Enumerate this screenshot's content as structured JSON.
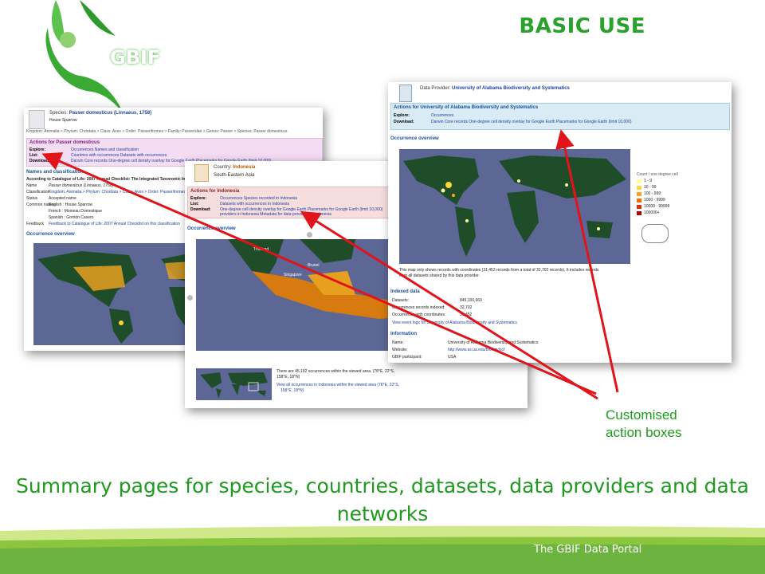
{
  "slide": {
    "title": "BASIC USE",
    "logo_text": "GBIF",
    "subtitle": "Summary pages for species, countries, datasets, data providers and data networks",
    "footer": "The GBIF Data Portal",
    "callout": "Customised action boxes"
  },
  "species_page": {
    "label": "Species:",
    "name": "Passer domesticus (Linnaeus, 1758)",
    "common_name": "House Sparrow",
    "taxonomy": "Kingdom: Animalia > Phylum: Chordata > Class: Aves > Order: Passeriformes > Family: Passeridae > Genus: Passer > Species: Passer domesticus",
    "actions_title": "Actions for Passer domesticus",
    "rows": [
      {
        "label": "Explore:",
        "value": "Occurrences    Names and classification"
      },
      {
        "label": "List:",
        "value": "Countries with occurrences    Datasets with occurrences"
      },
      {
        "label": "Download:",
        "value": "Darwin Core records    One-degree cell density overlay for Google Earth    Placemarks for Google Earth (limit 10,000)"
      }
    ],
    "names_title": "Names and classification",
    "checklist": "According to Catalogue of Life: 2007 Annual Checklist: The Integrated Taxonomic Information System",
    "details": [
      {
        "label": "Name",
        "value": "Passer domesticus (Linnaeus, 1758)"
      },
      {
        "label": "Classification",
        "value": "Kingdom: Animalia > Phylum: Chordata > Class: Aves > Order: Passeriformes"
      },
      {
        "label": "Status",
        "value": "Accepted name"
      },
      {
        "label": "Common names",
        "value": "English : House Sparrow"
      },
      {
        "label": "",
        "value": "French : Moineau Domestique"
      },
      {
        "label": "",
        "value": "Spanish : Gorrión Casero"
      },
      {
        "label": "Feedback",
        "value": "Feedback to Catalogue of Life: 2007 Annual Checklist on this classification"
      }
    ],
    "occ_title": "Occurrence overview"
  },
  "country_page": {
    "label": "Country:",
    "name": "Indonesia",
    "region": "South-Eastern Asia",
    "actions_title": "Actions for Indonesia",
    "rows": [
      {
        "label": "Explore:",
        "value": "Occurrences    Species recorded in Indonesia"
      },
      {
        "label": "List:",
        "value": "Datasets with occurrences in Indonesia"
      },
      {
        "label": "Download:",
        "value": "One-degree cell density overlay for Google Earth    Placemarks for Google Earth (limit 10,000)"
      },
      {
        "label": "",
        "value": "providers in Indonesia    Metadata for data providers in Indonesia"
      }
    ],
    "occ_title": "Occurrence overview",
    "map_labels": [
      "Thailand",
      "Brunei",
      "Singapore"
    ],
    "summary_1": "There are 45,192 occurrences within the viewed area. (78°E, 22°S,",
    "summary_2": "158°E, 18°N)",
    "view_link_1": "View all occurrences in Indonesia within the viewed area (78°E, 22°S,",
    "view_link_2": "158°E, 18°N)"
  },
  "provider_page": {
    "label": "Data Provider:",
    "name": "University of Alabama Biodiversity and Systematics",
    "actions_title": "Actions for University of Alabama Biodiversity and Systematics",
    "rows": [
      {
        "label": "Explore:",
        "value": "Occurrences"
      },
      {
        "label": "Download:",
        "value": "Darwin Core records    One-degree cell density overlay for Google Earth    Placemarks for Google Earth (limit 10,000)"
      }
    ],
    "occ_title": "Occurrence overview",
    "legend_title": "Count / one degree cell",
    "legend": [
      {
        "label": "1 - 9",
        "color": "#ffff99"
      },
      {
        "label": "10 - 99",
        "color": "#ffd633"
      },
      {
        "label": "100 - 999",
        "color": "#ffa31a"
      },
      {
        "label": "1000 - 9999",
        "color": "#ff6a00"
      },
      {
        "label": "10000 - 99999",
        "color": "#e62e00"
      },
      {
        "label": "100000+",
        "color": "#b30000"
      }
    ],
    "map_note_1": "This map only shows records with coordinates (31,452 records from a total of 32,702 records). It includes records",
    "map_note_2": "from all datasets shared by this data provider.",
    "indexed_title": "Indexed data",
    "indexed": [
      {
        "label": "Datasets:",
        "value": "845,100,660"
      },
      {
        "label": "Occurrences records indexed:",
        "value": "32,702"
      },
      {
        "label": "Occurrences with coordinates:",
        "value": "31,452"
      }
    ],
    "event_link": "View event logs for University of Alabama Biodiversity and Systematics",
    "info_title": "Information",
    "info": [
      {
        "label": "Name:",
        "value": "University of Alabama Biodiversity and Systematics"
      },
      {
        "label": "Website:",
        "value": "http://www.as.ua.edu/biology/scf"
      },
      {
        "label": "GBIF participant:",
        "value": "USA"
      }
    ]
  },
  "colors": {
    "brand_green": "#2aa12c",
    "arrow_red": "#e0141a",
    "map_ocean": "#5c6796",
    "land": "#1f4d2a"
  }
}
